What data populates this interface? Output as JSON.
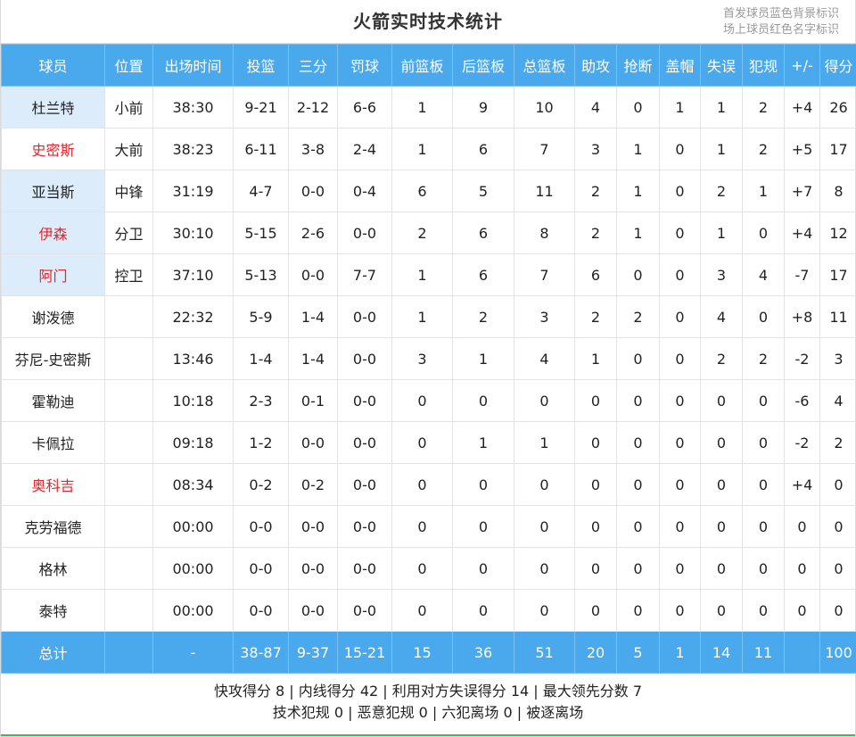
{
  "header": {
    "title": "火箭实时技术统计",
    "legend_starter": "首发球员蓝色背景标识",
    "legend_oncourt": "场上球员红色名字标识"
  },
  "columns": [
    "球员",
    "位置",
    "出场时间",
    "投篮",
    "三分",
    "罚球",
    "前篮板",
    "后篮板",
    "总篮板",
    "助攻",
    "抢断",
    "盖帽",
    "失误",
    "犯规",
    "+/-",
    "得分"
  ],
  "players": [
    {
      "name": "杜兰特",
      "pos": "小前",
      "min": "38:30",
      "fg": "9-21",
      "tp": "2-12",
      "ft": "6-6",
      "oreb": "1",
      "dreb": "9",
      "reb": "10",
      "ast": "4",
      "stl": "0",
      "blk": "1",
      "tov": "1",
      "pf": "2",
      "pm": "+4",
      "pts": "26",
      "starter": true,
      "on_court": false
    },
    {
      "name": "史密斯",
      "pos": "大前",
      "min": "38:23",
      "fg": "6-11",
      "tp": "3-8",
      "ft": "2-4",
      "oreb": "1",
      "dreb": "6",
      "reb": "7",
      "ast": "3",
      "stl": "1",
      "blk": "0",
      "tov": "1",
      "pf": "2",
      "pm": "+5",
      "pts": "17",
      "starter": false,
      "on_court": true
    },
    {
      "name": "亚当斯",
      "pos": "中锋",
      "min": "31:19",
      "fg": "4-7",
      "tp": "0-0",
      "ft": "0-4",
      "oreb": "6",
      "dreb": "5",
      "reb": "11",
      "ast": "2",
      "stl": "1",
      "blk": "0",
      "tov": "2",
      "pf": "1",
      "pm": "+7",
      "pts": "8",
      "starter": true,
      "on_court": false
    },
    {
      "name": "伊森",
      "pos": "分卫",
      "min": "30:10",
      "fg": "5-15",
      "tp": "2-6",
      "ft": "0-0",
      "oreb": "2",
      "dreb": "6",
      "reb": "8",
      "ast": "2",
      "stl": "1",
      "blk": "0",
      "tov": "1",
      "pf": "0",
      "pm": "+4",
      "pts": "12",
      "starter": true,
      "on_court": true
    },
    {
      "name": "阿门",
      "pos": "控卫",
      "min": "37:10",
      "fg": "5-13",
      "tp": "0-0",
      "ft": "7-7",
      "oreb": "1",
      "dreb": "6",
      "reb": "7",
      "ast": "6",
      "stl": "0",
      "blk": "0",
      "tov": "3",
      "pf": "4",
      "pm": "-7",
      "pts": "17",
      "starter": true,
      "on_court": true
    },
    {
      "name": "谢泼德",
      "pos": "",
      "min": "22:32",
      "fg": "5-9",
      "tp": "1-4",
      "ft": "0-0",
      "oreb": "1",
      "dreb": "2",
      "reb": "3",
      "ast": "2",
      "stl": "2",
      "blk": "0",
      "tov": "4",
      "pf": "0",
      "pm": "+8",
      "pts": "11",
      "starter": false,
      "on_court": false
    },
    {
      "name": "芬尼-史密斯",
      "pos": "",
      "min": "13:46",
      "fg": "1-4",
      "tp": "1-4",
      "ft": "0-0",
      "oreb": "3",
      "dreb": "1",
      "reb": "4",
      "ast": "1",
      "stl": "0",
      "blk": "0",
      "tov": "2",
      "pf": "2",
      "pm": "-2",
      "pts": "3",
      "starter": false,
      "on_court": false
    },
    {
      "name": "霍勒迪",
      "pos": "",
      "min": "10:18",
      "fg": "2-3",
      "tp": "0-1",
      "ft": "0-0",
      "oreb": "0",
      "dreb": "0",
      "reb": "0",
      "ast": "0",
      "stl": "0",
      "blk": "0",
      "tov": "0",
      "pf": "0",
      "pm": "-6",
      "pts": "4",
      "starter": false,
      "on_court": false
    },
    {
      "name": "卡佩拉",
      "pos": "",
      "min": "09:18",
      "fg": "1-2",
      "tp": "0-0",
      "ft": "0-0",
      "oreb": "0",
      "dreb": "1",
      "reb": "1",
      "ast": "0",
      "stl": "0",
      "blk": "0",
      "tov": "0",
      "pf": "0",
      "pm": "-2",
      "pts": "2",
      "starter": false,
      "on_court": false
    },
    {
      "name": "奥科吉",
      "pos": "",
      "min": "08:34",
      "fg": "0-2",
      "tp": "0-2",
      "ft": "0-0",
      "oreb": "0",
      "dreb": "0",
      "reb": "0",
      "ast": "0",
      "stl": "0",
      "blk": "0",
      "tov": "0",
      "pf": "0",
      "pm": "+4",
      "pts": "0",
      "starter": false,
      "on_court": true
    },
    {
      "name": "克劳福德",
      "pos": "",
      "min": "00:00",
      "fg": "0-0",
      "tp": "0-0",
      "ft": "0-0",
      "oreb": "0",
      "dreb": "0",
      "reb": "0",
      "ast": "0",
      "stl": "0",
      "blk": "0",
      "tov": "0",
      "pf": "0",
      "pm": "0",
      "pts": "0",
      "starter": false,
      "on_court": false
    },
    {
      "name": "格林",
      "pos": "",
      "min": "00:00",
      "fg": "0-0",
      "tp": "0-0",
      "ft": "0-0",
      "oreb": "0",
      "dreb": "0",
      "reb": "0",
      "ast": "0",
      "stl": "0",
      "blk": "0",
      "tov": "0",
      "pf": "0",
      "pm": "0",
      "pts": "0",
      "starter": false,
      "on_court": false
    },
    {
      "name": "泰特",
      "pos": "",
      "min": "00:00",
      "fg": "0-0",
      "tp": "0-0",
      "ft": "0-0",
      "oreb": "0",
      "dreb": "0",
      "reb": "0",
      "ast": "0",
      "stl": "0",
      "blk": "0",
      "tov": "0",
      "pf": "0",
      "pm": "0",
      "pts": "0",
      "starter": false,
      "on_court": false
    }
  ],
  "totals": {
    "name": "总计",
    "pos": "",
    "min": "-",
    "fg": "38-87",
    "tp": "9-37",
    "ft": "15-21",
    "oreb": "15",
    "dreb": "36",
    "reb": "51",
    "ast": "20",
    "stl": "5",
    "blk": "1",
    "tov": "14",
    "pf": "11",
    "pm": "",
    "pts": "100"
  },
  "summary": {
    "line1": "快攻得分 8 | 内线得分 42 | 利用对方失误得分 14 | 最大领先分数 7",
    "line2": "技术犯规 0 | 恶意犯规 0 | 六犯离场 0 | 被逐离场"
  },
  "colors": {
    "header_bg": "#4aa8ec",
    "starter_bg": "#dcecfb",
    "on_court_text": "#e8242b",
    "footer_rule": "#4caf6e"
  }
}
